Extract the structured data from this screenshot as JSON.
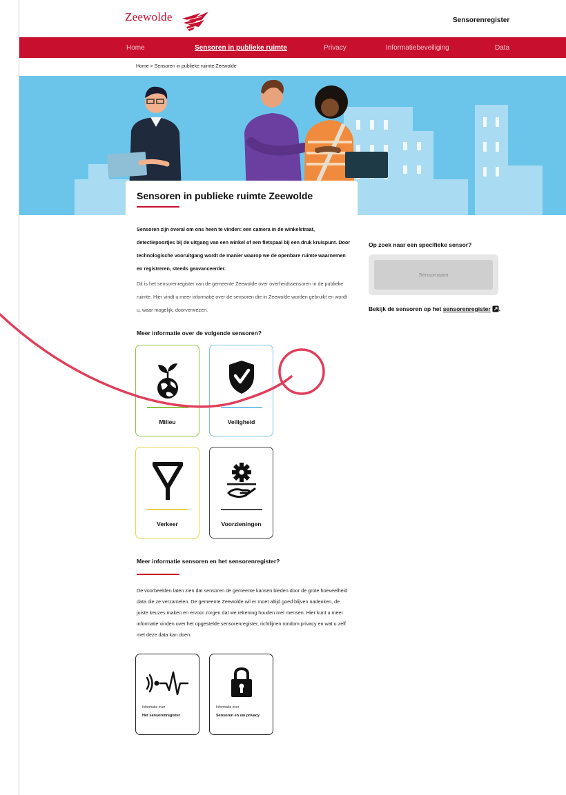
{
  "header": {
    "logo_text": "Zeewolde",
    "site_link": "Sensorenregister"
  },
  "nav": {
    "items": [
      {
        "label": "Home"
      },
      {
        "label": "Sensoren in publieke ruimte"
      },
      {
        "label": "Privacy"
      },
      {
        "label": "Informatiebeveiliging"
      },
      {
        "label": "Data"
      }
    ]
  },
  "breadcrumb": "Home > Sensoren in publieke ruimte Zeewolde",
  "page": {
    "title": "Sensoren in publieke ruimte Zeewolde",
    "intro_bold": "Sensoren zijn overal om ons heen te vinden: een camera in de winkelstraat, detectiepoortjes bij de uitgang van een winkel of een fietspaal bij een druk kruispunt. Door technologische vooruitgang wordt de manier waarop we de openbare ruimte waarnemen en registreren, steeds geavanceerder.",
    "intro_text": "Dit is het sensorenregister van de gemeente Zeewolde over overheidssensoren in de publieke ruimte. Hier vindt u meer informatie over de sensoren die in Zeewolde worden gebruikt en wordt u, waar mogelijk, doorverwezen."
  },
  "section1": {
    "title": "Meer informatie over de volgende sensoren?",
    "tiles": [
      {
        "label": "Milieu",
        "icon": "earth-plant-icon"
      },
      {
        "label": "Veiligheid",
        "icon": "shield-check-icon"
      },
      {
        "label": "Verkeer",
        "icon": "yield-sign-icon"
      },
      {
        "label": "Voorzieningen",
        "icon": "gear-hand-icon"
      }
    ]
  },
  "section2": {
    "title": "Meer informatie sensoren en het sensorenregister?",
    "text": "De voorbeelden laten zien dat sensoren de gemeente kansen bieden door de grote hoeveelheid data die ze verzamelen. De gemeente Zeewolde wil er moet altijd goed blijven nadenken, de juiste keuzes maken en ervoor zorgen dat we rekening houden met mensen. Hier kunt u meer informatie vinden over het opgestelde sensorenregister, richtlijnen rondom privacy en wat u zelf met deze data kan doen.",
    "tiles": [
      {
        "small": "Informatie over",
        "label": "Het sensorenregister",
        "icon": "sensor-signal-icon"
      },
      {
        "small": "Informatie over",
        "label": "Sensoren en uw privacy",
        "icon": "padlock-icon"
      }
    ]
  },
  "sidebar": {
    "question": "Op zoek naar een specifieke sensor?",
    "search_placeholder": "Sensornaam",
    "link_prefix": "Bekijk de sensoren op het ",
    "link_text": "sensorenregister",
    "link_suffix": "."
  },
  "colors": {
    "brand_red": "#c8102e",
    "hero_blue": "#6bc5ea",
    "milieu_green": "#8cc63f",
    "veiligheid_blue": "#7cc1e8",
    "verkeer_yellow": "#e8d44d",
    "voorzieningen_gray": "#444444"
  }
}
